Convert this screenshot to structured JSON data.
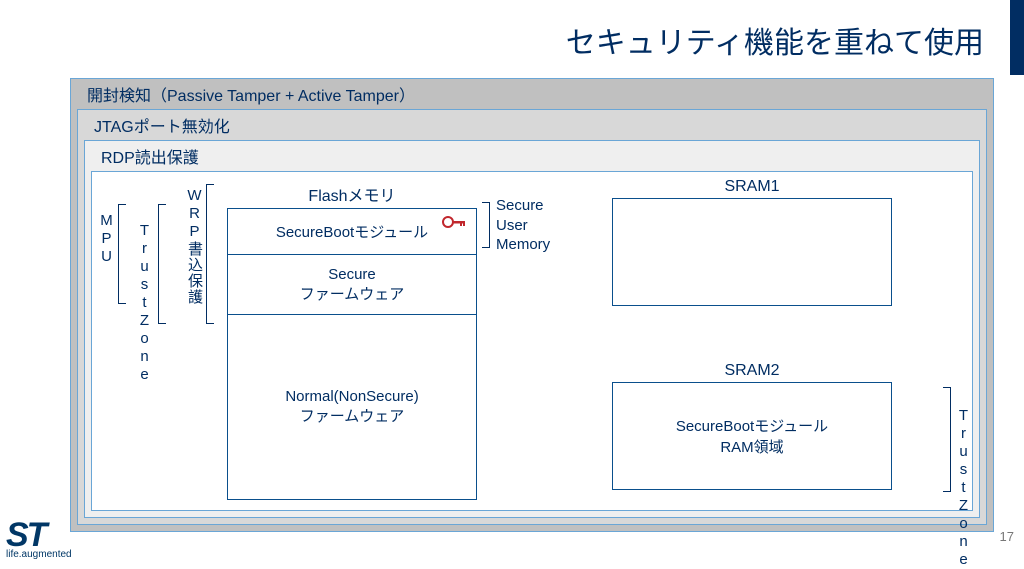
{
  "title": "セキュリティ機能を重ねて使用",
  "layers": {
    "l1": "開封検知（Passive Tamper + Active Tamper）",
    "l2": "JTAGポート無効化",
    "l3": "RDP読出保護"
  },
  "verticals": {
    "mpu": "MPU",
    "trustzone": "TrustZone",
    "wrp": "WRP書込保護"
  },
  "flash": {
    "title": "Flashメモリ",
    "secureboot": "SecureBootモジュール",
    "securefw_l1": "Secure",
    "securefw_l2": "ファームウェア",
    "normal_l1": "Normal(NonSecure)",
    "normal_l2": "ファームウェア"
  },
  "sum": {
    "l1": "Secure",
    "l2": "User",
    "l3": "Memory"
  },
  "sram1": {
    "title": "SRAM1"
  },
  "sram2": {
    "title": "SRAM2",
    "content_l1": "SecureBootモジュール",
    "content_l2": "RAM領域"
  },
  "trustzone_right": "TrustZone",
  "footer": {
    "brand": "ST",
    "tagline": "life.augmented",
    "page": "17"
  }
}
